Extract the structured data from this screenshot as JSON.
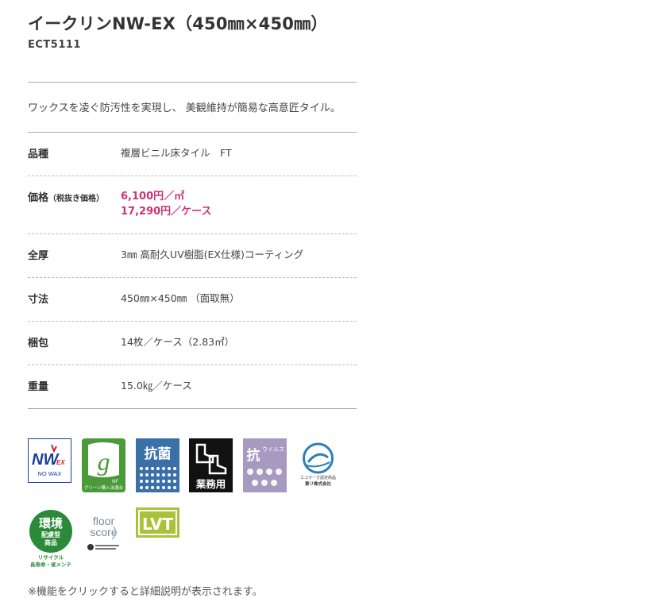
{
  "product": {
    "title": "イークリンNW-EX（450㎜×450㎜）",
    "code": "ECT5111",
    "description": "ワックスを凌ぐ防汚性を実現し、 美観維持が簡易な高意匠タイル。"
  },
  "specs": {
    "kind": {
      "label": "品種",
      "value": "複層ビニル床タイル　FT"
    },
    "price": {
      "label": "価格",
      "label_sub": "（税抜き価格）",
      "value_sqm": "6,100円／㎡",
      "value_case": "17,290円／ケース"
    },
    "thickness": {
      "label": "全厚",
      "value": "3㎜ 高耐久UV樹脂(EX仕様)コーティング"
    },
    "size": {
      "label": "寸法",
      "value": "450㎜×450㎜ （面取無）"
    },
    "packing": {
      "label": "梱包",
      "value": "14枚／ケース（2.83㎡）"
    },
    "weight": {
      "label": "重量",
      "value": "15.0㎏／ケース"
    }
  },
  "badges": {
    "nowax": {
      "logo": "NW",
      "sup": "EX",
      "caption": "NO WAX",
      "icon": "nowax-ex-icon",
      "color": "#1a3f9a"
    },
    "green": {
      "letter": "g",
      "small": "NF",
      "caption": "グリーン購入法適合",
      "icon": "green-purchase-icon",
      "color": "#4a9a3a"
    },
    "antibac": {
      "text": "抗菌",
      "icon": "antibacterial-icon",
      "color": "#3a6fa8"
    },
    "business": {
      "text": "業務用",
      "icon": "business-shoes-icon",
      "color": "#111111"
    },
    "antivirus": {
      "text": "抗",
      "sub": "ウイルス",
      "icon": "antivirus-icon",
      "color": "#a69ac0"
    },
    "ecomark": {
      "caption1": "エコマーク認定商品",
      "caption2": "東リ株式会社",
      "icon": "ecomark-icon",
      "color": "#2a7fb8"
    },
    "env": {
      "line1": "環境",
      "line2": "配慮型",
      "line3": "商品",
      "caption1": "リサイクル",
      "caption2": "長寿命・省メンテ",
      "icon": "environment-icon",
      "color": "#2a8a3a"
    },
    "floorscore": {
      "line1": "floor",
      "line2": "score",
      "icon": "floorscore-icon",
      "color": "#7a8a99"
    },
    "lvt": {
      "text": "LVT",
      "icon": "lvt-icon",
      "color": "#a8c23a"
    }
  },
  "note": "※機能をクリックすると詳細説明が表示されます。"
}
